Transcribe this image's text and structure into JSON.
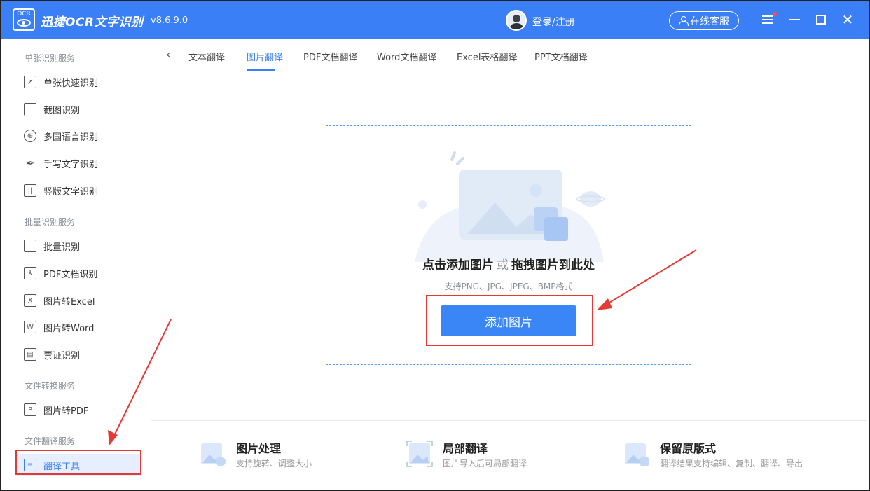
{
  "titlebar": {
    "logo_text": "OCR",
    "app_name": "迅捷OCR文字识别",
    "version": "v8.6.9.0",
    "login": "登录/注册",
    "service": "在线客服"
  },
  "sidebar": {
    "sections": [
      {
        "title": "单张识别服务",
        "items": [
          "单张快速识别",
          "截图识别",
          "多国语言识别",
          "手写文字识别",
          "竖版文字识别"
        ]
      },
      {
        "title": "批量识别服务",
        "items": [
          "批量识别",
          "PDF文档识别",
          "图片转Excel",
          "图片转Word",
          "票证识别"
        ]
      },
      {
        "title": "文件转换服务",
        "items": [
          "图片转PDF"
        ]
      },
      {
        "title": "文件翻译服务",
        "items": [
          "翻译工具"
        ]
      }
    ]
  },
  "tabs": [
    "文本翻译",
    "图片翻译",
    "PDF文档翻译",
    "Word文档翻译",
    "Excel表格翻译",
    "PPT文档翻译"
  ],
  "active_tab": "图片翻译",
  "dropzone": {
    "title_a": "点击添加图片",
    "or": "或",
    "title_b": "拖拽图片到此处",
    "formats": "支持PNG、JPG、JPEG、BMP格式",
    "button": "添加图片"
  },
  "features": [
    {
      "title": "图片处理",
      "desc": "支持旋转、调整大小"
    },
    {
      "title": "局部翻译",
      "desc": "图片导入后可局部翻译"
    },
    {
      "title": "保留原版式",
      "desc": "翻译结果支持编辑、复制、翻译、导出"
    }
  ],
  "colors": {
    "brand": "#3a7ff6",
    "annotation": "#e53935"
  },
  "icons": [
    "ocr-logo-icon",
    "avatar",
    "person-icon",
    "menu-icon",
    "minimize-icon",
    "maximize-icon",
    "close-icon",
    "back-arrow-icon"
  ]
}
